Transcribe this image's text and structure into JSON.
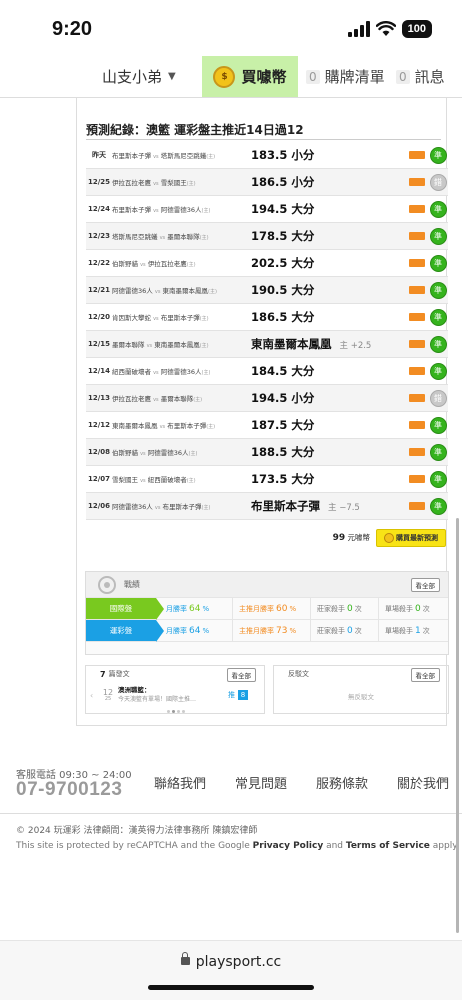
{
  "status": {
    "time": "9:20",
    "battery": "100"
  },
  "nav": {
    "user": "山支小弟",
    "buy_label": "買噱幣",
    "cart_count": "0",
    "cart_label": "購牌清單",
    "msg_count": "0",
    "msg_label": "訊息"
  },
  "record": {
    "title": "預測紀錄：澳籃 運彩盤主推近14日過12",
    "rows": [
      {
        "date": "昨天",
        "home": "布里斯本子彈",
        "away": "塔斯馬尼亞跳蟻",
        "pred": "183.5 小分",
        "sub": "",
        "result": "準"
      },
      {
        "date": "12/25",
        "home": "伊拉瓦拉老鷹",
        "away": "雪梨國王",
        "pred": "186.5 小分",
        "sub": "",
        "result": "錯"
      },
      {
        "date": "12/24",
        "home": "布里斯本子彈",
        "away": "阿德雷德36人",
        "pred": "194.5 大分",
        "sub": "",
        "result": "準"
      },
      {
        "date": "12/23",
        "home": "塔斯馬尼亞跳蟻",
        "away": "墨爾本聯隊",
        "pred": "178.5 大分",
        "sub": "",
        "result": "準"
      },
      {
        "date": "12/22",
        "home": "伯斯野貓",
        "away": "伊拉瓦拉老鷹",
        "pred": "202.5 大分",
        "sub": "",
        "result": "準"
      },
      {
        "date": "12/21",
        "home": "阿德雷德36人",
        "away": "東南墨爾本鳳凰",
        "pred": "190.5 大分",
        "sub": "",
        "result": "準"
      },
      {
        "date": "12/20",
        "home": "肯因斯大攀蛇",
        "away": "布里斯本子彈",
        "pred": "186.5 大分",
        "sub": "",
        "result": "準"
      },
      {
        "date": "12/15",
        "home": "墨爾本聯隊",
        "away": "東南墨爾本鳳凰",
        "pred": "東南墨爾本鳳凰",
        "sub": "主 +2.5",
        "result": "準"
      },
      {
        "date": "12/14",
        "home": "紐西蘭破壞者",
        "away": "阿德雷德36人",
        "pred": "184.5 大分",
        "sub": "",
        "result": "準"
      },
      {
        "date": "12/13",
        "home": "伊拉瓦拉老鷹",
        "away": "墨爾本聯隊",
        "pred": "194.5 小分",
        "sub": "",
        "result": "錯"
      },
      {
        "date": "12/12",
        "home": "東南墨爾本鳳凰",
        "away": "布里斯本子彈",
        "pred": "187.5 大分",
        "sub": "",
        "result": "準"
      },
      {
        "date": "12/08",
        "home": "伯斯野貓",
        "away": "阿德雷德36人",
        "pred": "188.5 大分",
        "sub": "",
        "result": "準"
      },
      {
        "date": "12/07",
        "home": "雪梨國王",
        "away": "紐西蘭破壞者",
        "pred": "173.5 大分",
        "sub": "",
        "result": "準"
      },
      {
        "date": "12/06",
        "home": "阿德雷德36人",
        "away": "布里斯本子彈",
        "pred": "布里斯本子彈",
        "sub": "主 −7.5",
        "result": "準"
      }
    ],
    "vs": "vs",
    "home_mark": "(主)",
    "price": "99",
    "price_unit": "元噱幣",
    "buy_pred_label": "購買最新預測"
  },
  "stats": {
    "title": "戰績",
    "view_all": "看全部",
    "rows": [
      {
        "label": "國際盤",
        "a_pre": "月勝率",
        "a_val": "64",
        "a_suf": "%",
        "b_pre": "主推月勝率",
        "b_val": "60",
        "b_suf": "%",
        "c_pre": "莊家殺手",
        "c_val": "0",
        "c_suf": "次",
        "d_pre": "單場殺手",
        "d_val": "0",
        "d_suf": "次"
      },
      {
        "label": "運彩盤",
        "a_pre": "月勝率",
        "a_val": "64",
        "a_suf": "%",
        "b_pre": "主推月勝率",
        "b_val": "73",
        "b_suf": "%",
        "c_pre": "莊家殺手",
        "c_val": "0",
        "c_suf": "次",
        "d_pre": "單場殺手",
        "d_val": "1",
        "d_suf": "次"
      }
    ]
  },
  "posts": {
    "count": "7",
    "count_label": "篇發文",
    "view_all": "看全部",
    "date_day": "12",
    "date_month": "25",
    "author": "澳洲職籃：",
    "snippet": "今天澳籃有單場！國際主推…",
    "tag": "推",
    "tag_count": "8",
    "rebuttal_title": "反駁文",
    "rebuttal_view_all": "看全部",
    "rebuttal_empty": "無反駁文"
  },
  "footer": {
    "service_label": "客服電話 09:30 ~ 24:00",
    "service_phone": "07-9700123",
    "links": [
      "聯絡我們",
      "常見問題",
      "服務條款",
      "關於我們"
    ],
    "copyright": "© 2024 玩運彩 法律顧問：漢英得力法律事務所 陳鎮宏律師",
    "recaptcha_pre": "This site is protected by reCAPTCHA and the Google ",
    "privacy": "Privacy Policy",
    "and": " and ",
    "terms": "Terms of Service",
    "apply": " apply."
  },
  "browser": {
    "url": "playsport.cc"
  },
  "colors": {
    "win": "#35b31d",
    "loss": "#c8c8c8",
    "intl": "#79c91f",
    "sports": "#1ba0e4",
    "buy_nav": "#c8f0a8"
  }
}
